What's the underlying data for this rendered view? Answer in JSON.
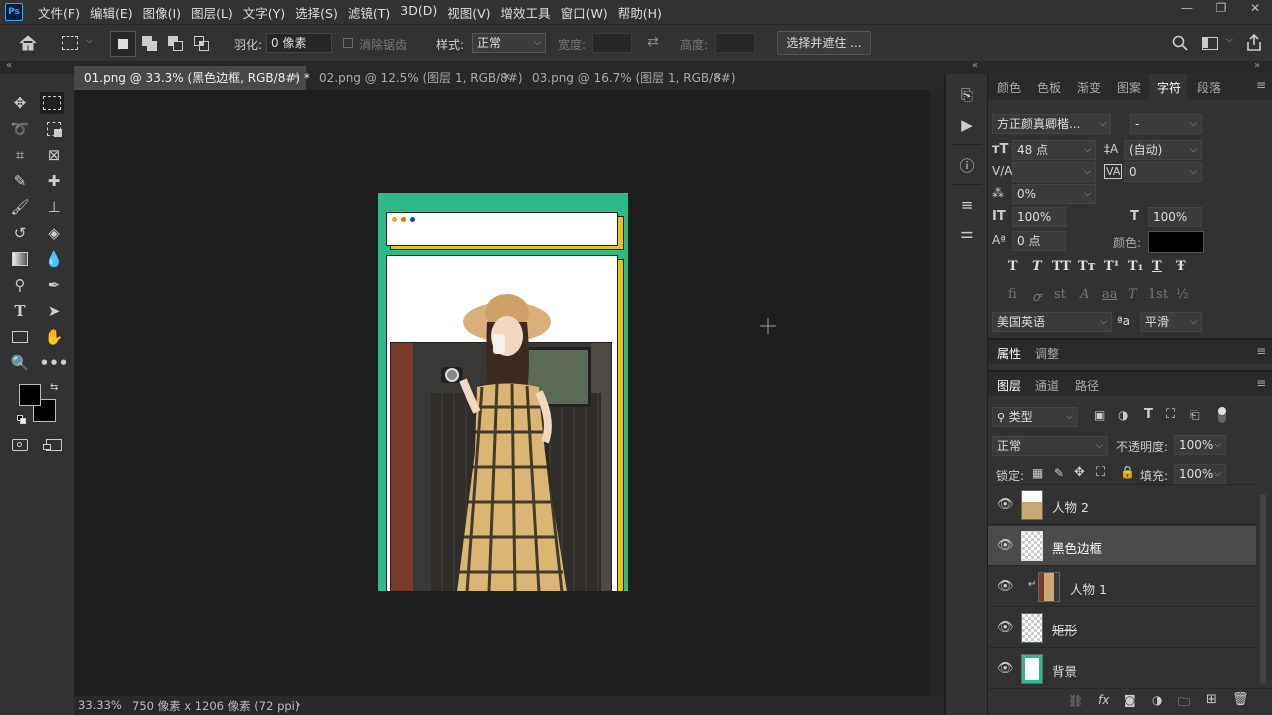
{
  "app": {
    "logo": "Ps"
  },
  "menu": [
    "文件(F)",
    "编辑(E)",
    "图像(I)",
    "图层(L)",
    "文字(Y)",
    "选择(S)",
    "滤镜(T)",
    "3D(D)",
    "视图(V)",
    "增效工具",
    "窗口(W)",
    "帮助(H)"
  ],
  "window_controls": {
    "minimize": "—",
    "restore": "❐",
    "close": "✕"
  },
  "options": {
    "feather_label": "羽化:",
    "feather_value": "0 像素",
    "antialias_label": "消除锯齿",
    "style_label": "样式:",
    "style_value": "正常",
    "width_label": "宽度:",
    "height_label": "高度:",
    "select_mask_button": "选择并遮住 ..."
  },
  "tabs": [
    {
      "label": "01.png @ 33.3% (黑色边框, RGB/8#) *"
    },
    {
      "label": "02.png @ 12.5% (图层 1, RGB/8#)"
    },
    {
      "label": "03.png @ 16.7% (图层 1, RGB/8#)"
    }
  ],
  "status": {
    "zoom": "33.33%",
    "doc_info": "750 像素 x 1206 像素 (72 ppi)",
    "arrow": "›"
  },
  "char_panel": {
    "tabs": [
      "颜色",
      "色板",
      "渐变",
      "图案",
      "字符",
      "段落"
    ],
    "active_tab": "字符",
    "font_family": "方正颜真卿楷...",
    "font_style": "-",
    "font_size": "48 点",
    "leading": "(自动)",
    "tracking": "0",
    "scale_pct": "0%",
    "vscale": "100%",
    "hscale": "100%",
    "baseline": "0 点",
    "color_label": "颜色:",
    "text_color": "#000000",
    "style_buttons": [
      "T",
      "T",
      "TT",
      "Tт",
      "T¹",
      "T₁",
      "T",
      "Ŧ"
    ],
    "opentype_buttons": [
      "fi",
      "ꝍ",
      "st",
      "A",
      "aa",
      "T",
      "1st",
      "½"
    ],
    "language": "美国英语",
    "aa_icon": "ªa",
    "antialias": "平滑"
  },
  "props_panel": {
    "tabs": [
      "属性",
      "调整"
    ],
    "active_tab": "属性"
  },
  "layers_panel": {
    "tabs": [
      "图层",
      "通道",
      "路径"
    ],
    "active_tab": "图层",
    "filter_kind": "类型",
    "blend_mode": "正常",
    "opacity_label": "不透明度:",
    "opacity": "100%",
    "lock_label": "锁定:",
    "fill_label": "填充:",
    "fill": "100%",
    "layers": [
      {
        "name": "人物 2",
        "visible": true,
        "selected": false,
        "thumb": "photo"
      },
      {
        "name": "黑色边框",
        "visible": true,
        "selected": true,
        "thumb": "checker"
      },
      {
        "name": "人物 1",
        "visible": true,
        "selected": false,
        "thumb": "photo",
        "clipped": true
      },
      {
        "name": "矩形",
        "visible": true,
        "selected": false,
        "thumb": "checker"
      },
      {
        "name": "背景",
        "visible": true,
        "selected": false,
        "thumb": "bg"
      }
    ]
  },
  "colors": {
    "accent_green": "#2fb98a",
    "selection": "#4b4b4b",
    "yellow_shadow": "#e8c41a"
  }
}
